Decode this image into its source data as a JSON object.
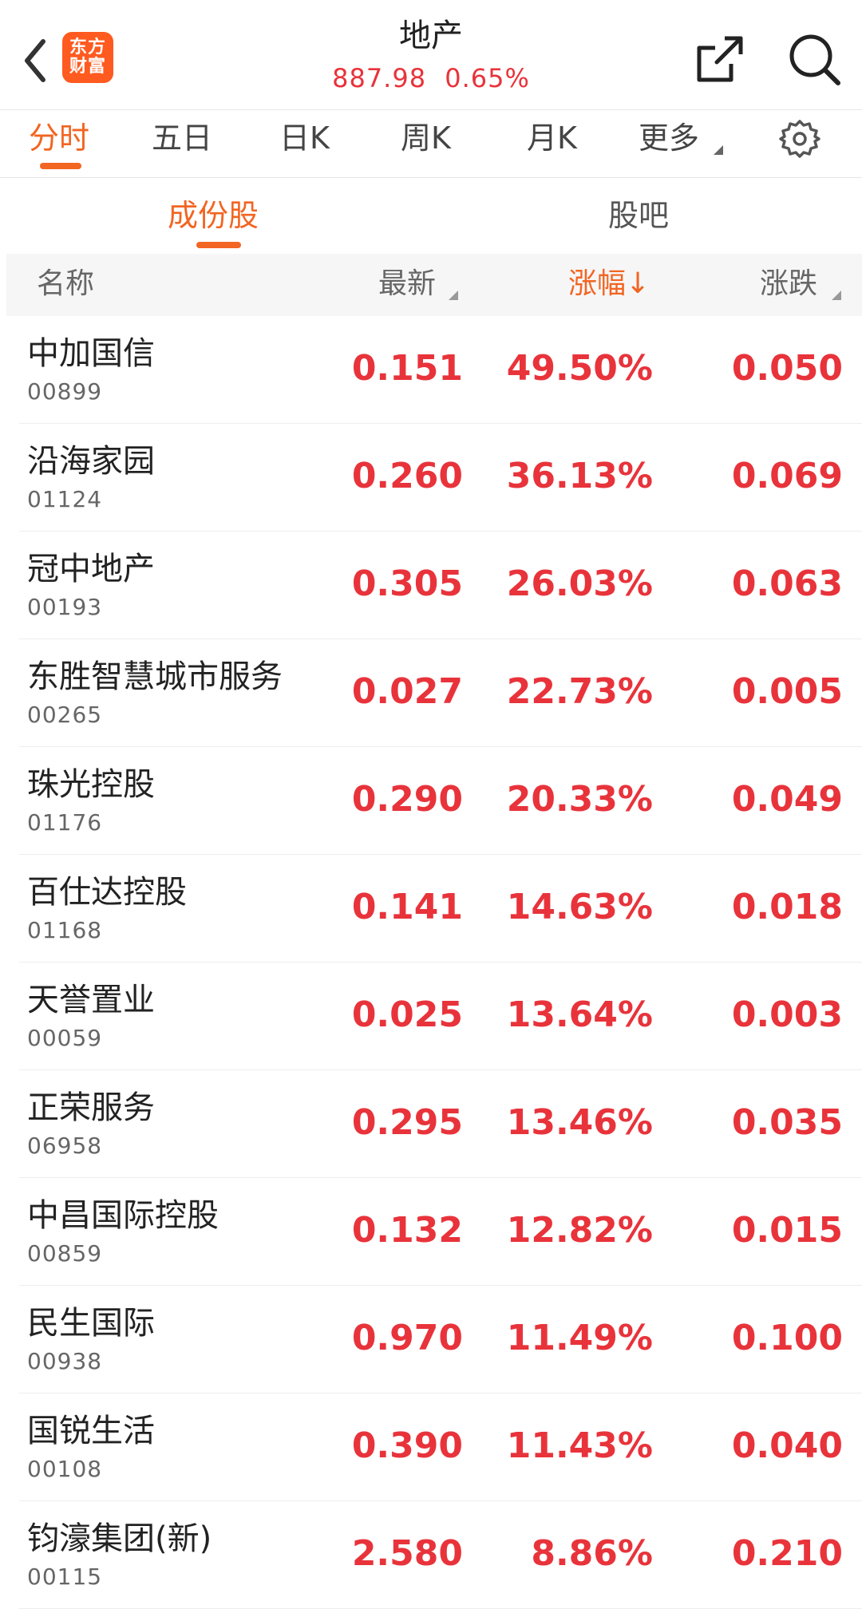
{
  "header": {
    "title": "地产",
    "price": "887.98",
    "change_pct": "0.65%",
    "logo_line1": "东方",
    "logo_line2": "财富"
  },
  "tabs": {
    "items": [
      "分时",
      "五日",
      "日K",
      "周K",
      "月K",
      "更多"
    ],
    "active": "分时"
  },
  "segment": {
    "items": [
      "成份股",
      "股吧"
    ],
    "active": "成份股"
  },
  "table": {
    "columns": {
      "name": "名称",
      "latest": "最新",
      "change_pct": "涨幅↓",
      "change": "涨跌"
    },
    "rows": [
      {
        "name": "中加国信",
        "code": "00899",
        "latest": "0.151",
        "change_pct": "49.50%",
        "change": "0.050"
      },
      {
        "name": "沿海家园",
        "code": "01124",
        "latest": "0.260",
        "change_pct": "36.13%",
        "change": "0.069"
      },
      {
        "name": "冠中地产",
        "code": "00193",
        "latest": "0.305",
        "change_pct": "26.03%",
        "change": "0.063"
      },
      {
        "name": "东胜智慧城市服务",
        "code": "00265",
        "latest": "0.027",
        "change_pct": "22.73%",
        "change": "0.005"
      },
      {
        "name": "珠光控股",
        "code": "01176",
        "latest": "0.290",
        "change_pct": "20.33%",
        "change": "0.049"
      },
      {
        "name": "百仕达控股",
        "code": "01168",
        "latest": "0.141",
        "change_pct": "14.63%",
        "change": "0.018"
      },
      {
        "name": "天誉置业",
        "code": "00059",
        "latest": "0.025",
        "change_pct": "13.64%",
        "change": "0.003"
      },
      {
        "name": "正荣服务",
        "code": "06958",
        "latest": "0.295",
        "change_pct": "13.46%",
        "change": "0.035"
      },
      {
        "name": "中昌国际控股",
        "code": "00859",
        "latest": "0.132",
        "change_pct": "12.82%",
        "change": "0.015"
      },
      {
        "name": "民生国际",
        "code": "00938",
        "latest": "0.970",
        "change_pct": "11.49%",
        "change": "0.100"
      },
      {
        "name": "国锐生活",
        "code": "00108",
        "latest": "0.390",
        "change_pct": "11.43%",
        "change": "0.040"
      },
      {
        "name": "钧濠集团(新)",
        "code": "00115",
        "latest": "2.580",
        "change_pct": "8.86%",
        "change": "0.210"
      }
    ]
  },
  "colors": {
    "accent": "#f26522",
    "rise": "#e8333b",
    "brand": "#ff5a1f"
  }
}
